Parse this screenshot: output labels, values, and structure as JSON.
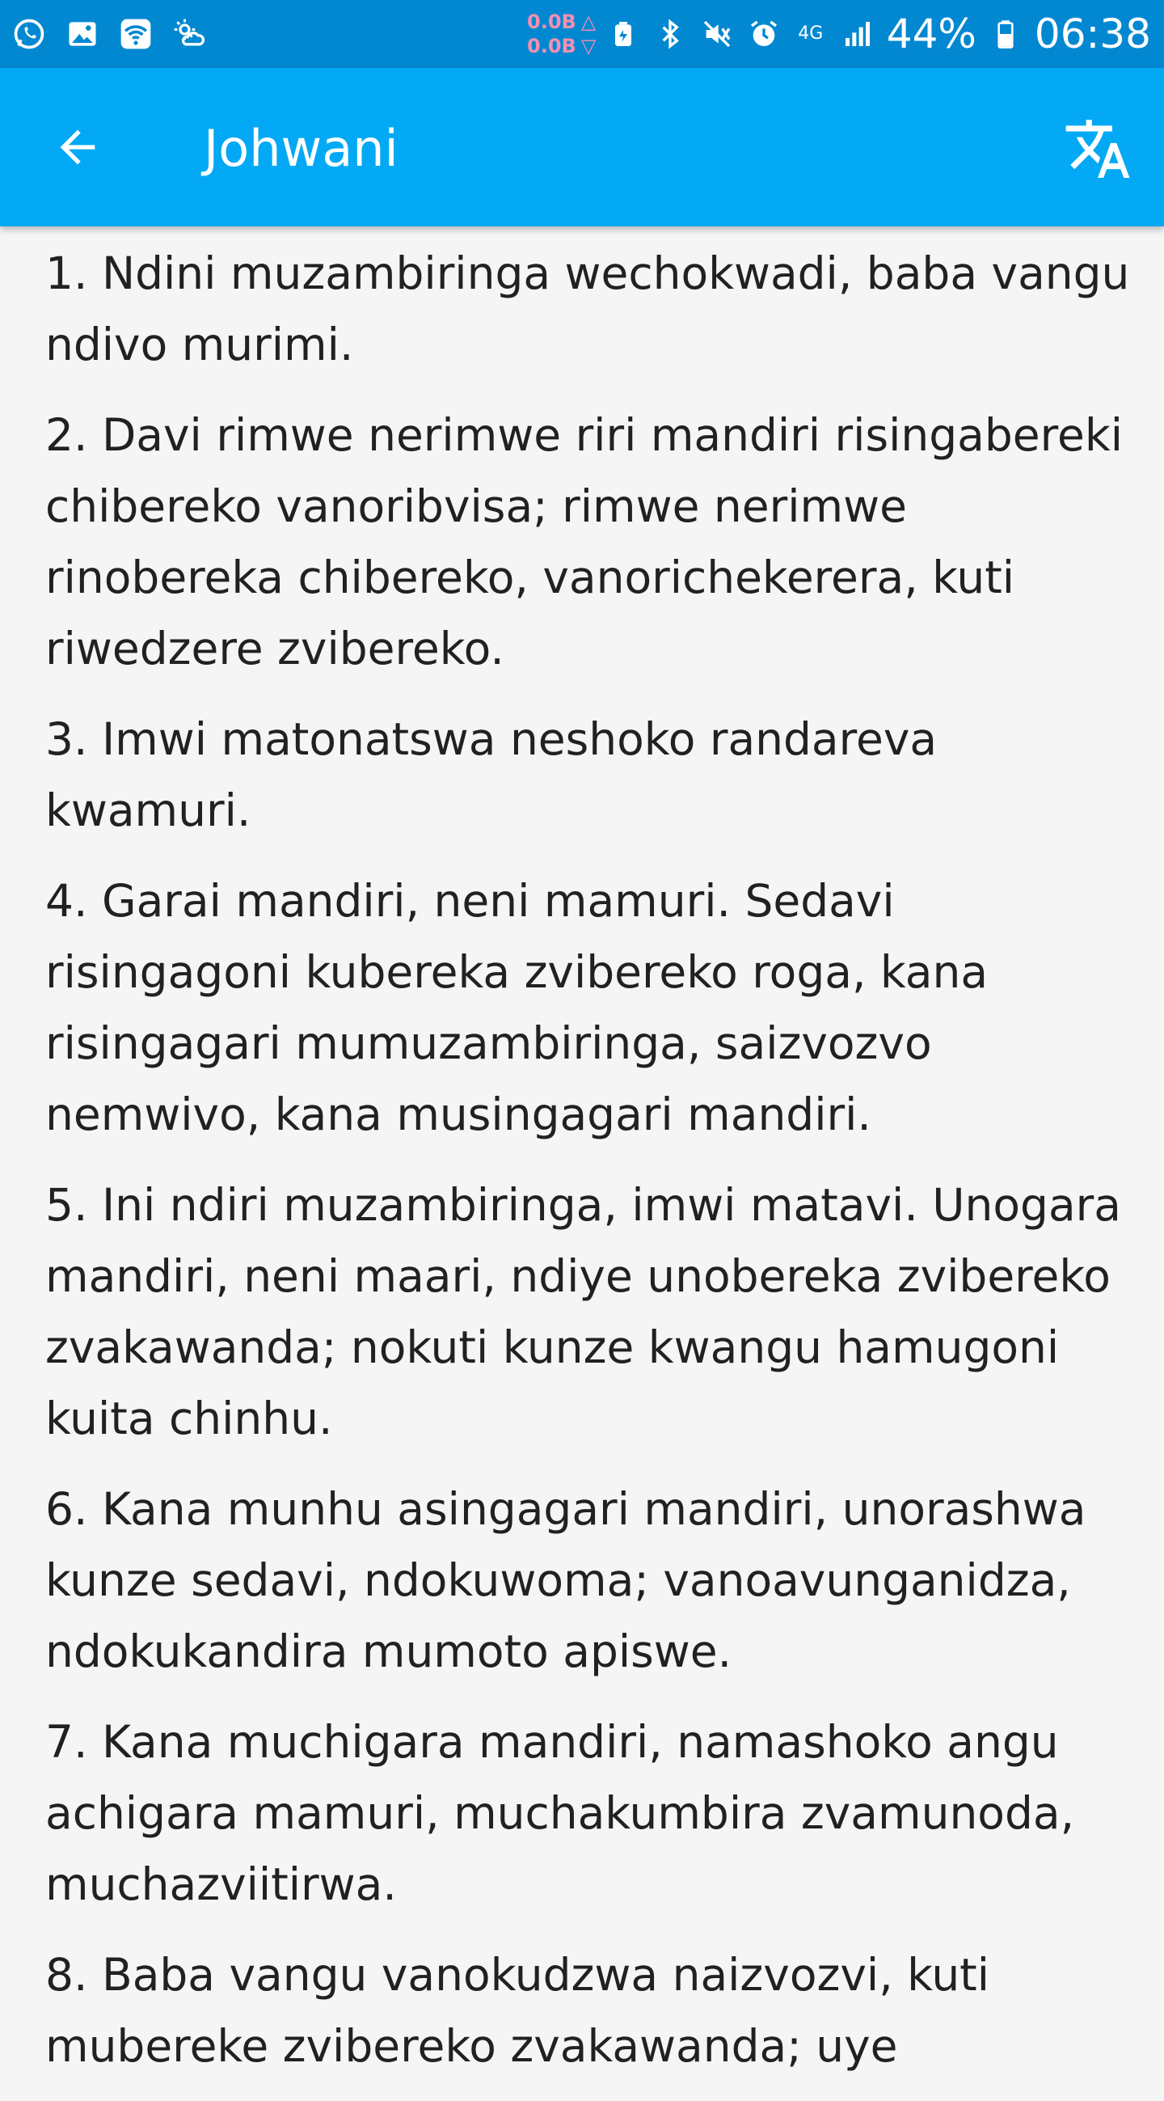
{
  "status_bar": {
    "net_up": "0.0B",
    "net_down": "0.0B",
    "network_type": "4G",
    "battery": "44%",
    "time": "06:38",
    "icons_left": [
      "whatsapp-icon",
      "gallery-icon",
      "wifi-icon",
      "weather-icon"
    ],
    "icons_right": [
      "battery-saver-icon",
      "bluetooth-icon",
      "mute-icon",
      "alarm-icon",
      "data-icon",
      "signal-icon",
      "battery-icon"
    ]
  },
  "toolbar": {
    "title": "Johwani",
    "back_icon": "arrow-back-icon",
    "translate_icon": "translate-icon"
  },
  "verses": [
    "1. Ndini muzambiringa wechokwadi, baba vangu ndivo murimi.",
    "2. Davi rimwe nerimwe riri mandiri risingabereki chibereko vanoribvisa; rimwe nerimwe rinobereka chibereko, vanorichekerera, kuti riwedzere zvibereko.",
    "3. Imwi matonatswa neshoko randareva kwamuri.",
    "4. Garai mandiri, neni mamuri. Sedavi risingagoni kubereka zvibereko roga, kana risingagari mumuzambiringa, saizvozvo nemwivo, kana musingagari mandiri.",
    "5. Ini ndiri muzambiringa, imwi matavi. Unogara mandiri, neni maari, ndiye unobereka zvibereko zvakawanda; nokuti kunze kwangu hamugoni kuita chinhu.",
    "6. Kana munhu asingagari mandiri, unorashwa kunze sedavi, ndokuwoma; vanoavunganidza, ndokukandira mumoto apiswe.",
    "7. Kana muchigara mandiri, namashoko angu achigara mamuri, muchakumbira zvamunoda, muchazviitirwa.",
    "8. Baba vangu vanokudzwa naizvozvi, kuti mubereke zvibereko zvakawanda; uye"
  ],
  "colors": {
    "status_bar": "#0288d1",
    "toolbar": "#03a9f4",
    "background": "#f5f5f5",
    "text": "#212121",
    "net_speed": "#f48fb1"
  }
}
